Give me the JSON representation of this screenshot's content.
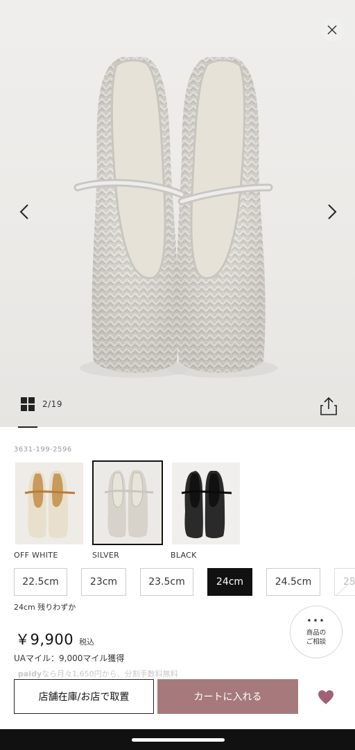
{
  "gallery": {
    "counter": "2/19",
    "colors": {
      "image_bg": "#ecebe8",
      "silver": "#d8d4cc"
    }
  },
  "product": {
    "sku": "3631-199-2596",
    "colors": [
      {
        "label": "OFF WHITE",
        "selected": false
      },
      {
        "label": "SILVER",
        "selected": true
      },
      {
        "label": "BLACK",
        "selected": false
      }
    ],
    "sizes": [
      "22.5cm",
      "23cm",
      "23.5cm",
      "24cm",
      "24.5cm",
      "25"
    ],
    "selected_size": "24cm",
    "stock_note": "24cm 残りわずか",
    "price": "￥9,900",
    "tax_label": "税込",
    "miles": "UAマイル：9,000マイル獲得",
    "paidy_brand": "paidy",
    "paidy_text": "なら月々1,650円から、分割手数料無料"
  },
  "consult": {
    "line1": "商品の",
    "line2": "ご相談"
  },
  "actions": {
    "store_label": "店舗在庫/お店で取置",
    "cart_label": "カートに入れる",
    "cart_color": "#a67a7c",
    "fav_color": "#a06076"
  },
  "icons": [
    "close-icon",
    "chevron-left-icon",
    "chevron-right-icon",
    "grid-icon",
    "share-icon",
    "heart-icon",
    "more-dots-icon"
  ]
}
